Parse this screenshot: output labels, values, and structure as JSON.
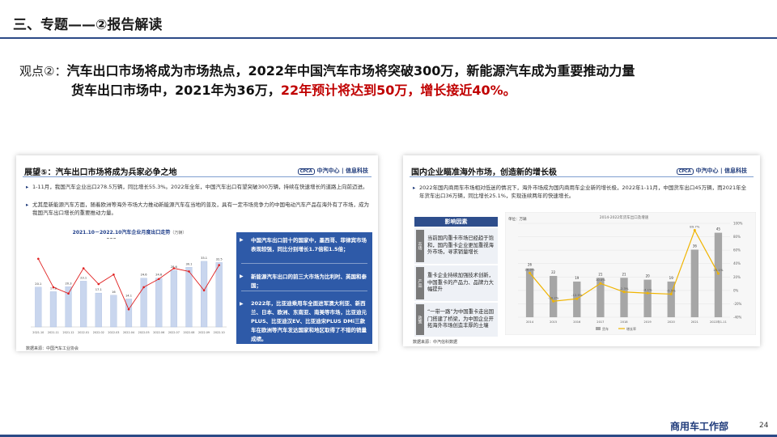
{
  "header": {
    "title": "三、专题——②报告解读"
  },
  "viewpoint": {
    "tag": "观点②：",
    "line1": "汽车出口市场将成为市场热点，2022年中国汽车市场将突破300万，新能源汽车成为重要推动力量",
    "line2_normal": "货车出口市场中，2021年为36万，",
    "line2_highlight": "22年预计将达到50万，增长接近40%。"
  },
  "left_panel": {
    "title": "展望⑤：汽车出口市场将成为兵家必争之地",
    "logo_box": "CPCA",
    "logo": "中汽中心 | 信息科技",
    "bullet1": "1-11月，我国汽车企业出口278.5万辆，同比增长55.3%。2022年全年，中国汽车出口有望突破300万辆，持续在快速增长的道路上向前迈进。",
    "bullet2": "尤其是新能源汽车方面，随着欧洲等海外市场大力推动新能源汽车在当地的普及，具有一定市场竞争力的中国电动汽车产品在海外有了市场，成为我国汽车出口增长的重要推动力量。",
    "chart_title": "2021.10－2022.10汽车企业月度出口走势",
    "chart_unit": "（万辆）",
    "box_items": [
      "中国汽车出口前十的国家中，墨西哥、菲律宾市场表现较强，同比分别增长1.7倍和1.5倍；",
      "新能源汽车出口的前三大市场为比利时、英国和泰国；",
      "2022年，比亚迪乘用车全面进军澳大利亚、新西兰、日本、欧洲、东南亚、南美等市场，比亚迪元PLUS、比亚迪汉EV、比亚迪宋PLUS DMi三款车在欧洲等汽车发达国家和地区取得了不错的销量成绩。"
    ],
    "source": "数据来源：中国汽车工业协会"
  },
  "right_panel": {
    "title": "国内企业瞄准海外市场，创造新的增长极",
    "logo_box": "CPCA",
    "logo": "中汽中心 | 信息科技",
    "bullet": "2022年国内商用车市场相对低迷的情况下，海外市场成为国内商用车企业新的增长极，2022年1-11月，中国货车出口45万辆，而2021年全年货车出口36万辆，同比增长25.1%，实现连续两年的快速增长。",
    "factors_header": "影响因素",
    "factors": [
      {
        "label": "市场",
        "text": "当前国内重卡市场已经趋于饱和，国内重卡企业更加重视海外市场，寻求销量增长"
      },
      {
        "label": "产品",
        "text": "重卡企业持续加强技术创新，中国重卡的产品力、品牌力大幅提升"
      },
      {
        "label": "政策",
        "text": "“一带一路”为中国重卡走出国门搭建了桥梁，为中国企业开拓海外市场创造丰厚的土壤"
      }
    ],
    "chart_title": "2014-2022年货车出口及增速",
    "y_unit": "单位：万辆",
    "source": "数据来源：中汽信科数据"
  },
  "chart_data": [
    {
      "type": "bar",
      "title": "2021.10－2022.10汽车企业月度出口走势",
      "unit": "万辆",
      "categories": [
        "2021.10",
        "2021.11",
        "2021.12",
        "2022.01",
        "2022.02",
        "2022.03",
        "2022.04",
        "2022.05",
        "2022.06",
        "2022.07",
        "2022.08",
        "2022.09",
        "2022.10"
      ],
      "series": [
        {
          "kind": "bar",
          "values": [
            20.1,
            17.8,
            20.3,
            23.1,
            17.1,
            16.0,
            14.1,
            24.6,
            24.6,
            28.6,
            30.1,
            33.1,
            32.5
          ]
        },
        {
          "kind": "line",
          "values": [
            70,
            25,
            15,
            55,
            30,
            45,
            -10,
            25,
            38,
            55,
            50,
            20,
            60
          ]
        }
      ],
      "legend_position": "top"
    },
    {
      "type": "bar",
      "title": "2014-2022年货车出口及增速",
      "categories": [
        "2014",
        "2015",
        "2016",
        "2017",
        "2018",
        "2019",
        "2020",
        "2021",
        "2022年1-11"
      ],
      "series": [
        {
          "name": "货车",
          "kind": "bar",
          "values": [
            26,
            22,
            19,
            21,
            21,
            20,
            19,
            36,
            45
          ]
        },
        {
          "name": "增长率",
          "kind": "line",
          "values": [
            26.0,
            -16.2,
            -12.5,
            10.4,
            -2.3,
            -4.1,
            -5.5,
            89.7,
            25.1
          ]
        }
      ],
      "ylim": [
        0,
        50
      ],
      "y2lim": [
        -40,
        100
      ],
      "y2_ticks": [
        "100%",
        "80%",
        "60%",
        "40%",
        "20%",
        "0%",
        "-20%",
        "-40%"
      ],
      "gridlines": true,
      "legend_position": "bottom"
    }
  ],
  "footer": {
    "dept": "商用车工作部",
    "page": "24"
  },
  "colors": {
    "accent": "#2c4a86",
    "highlight": "#c00000",
    "bar_light": "#c9d6ee",
    "line_red": "#e02020",
    "bar_gray": "#a6a6a6",
    "line_yellow": "#f0b400"
  }
}
